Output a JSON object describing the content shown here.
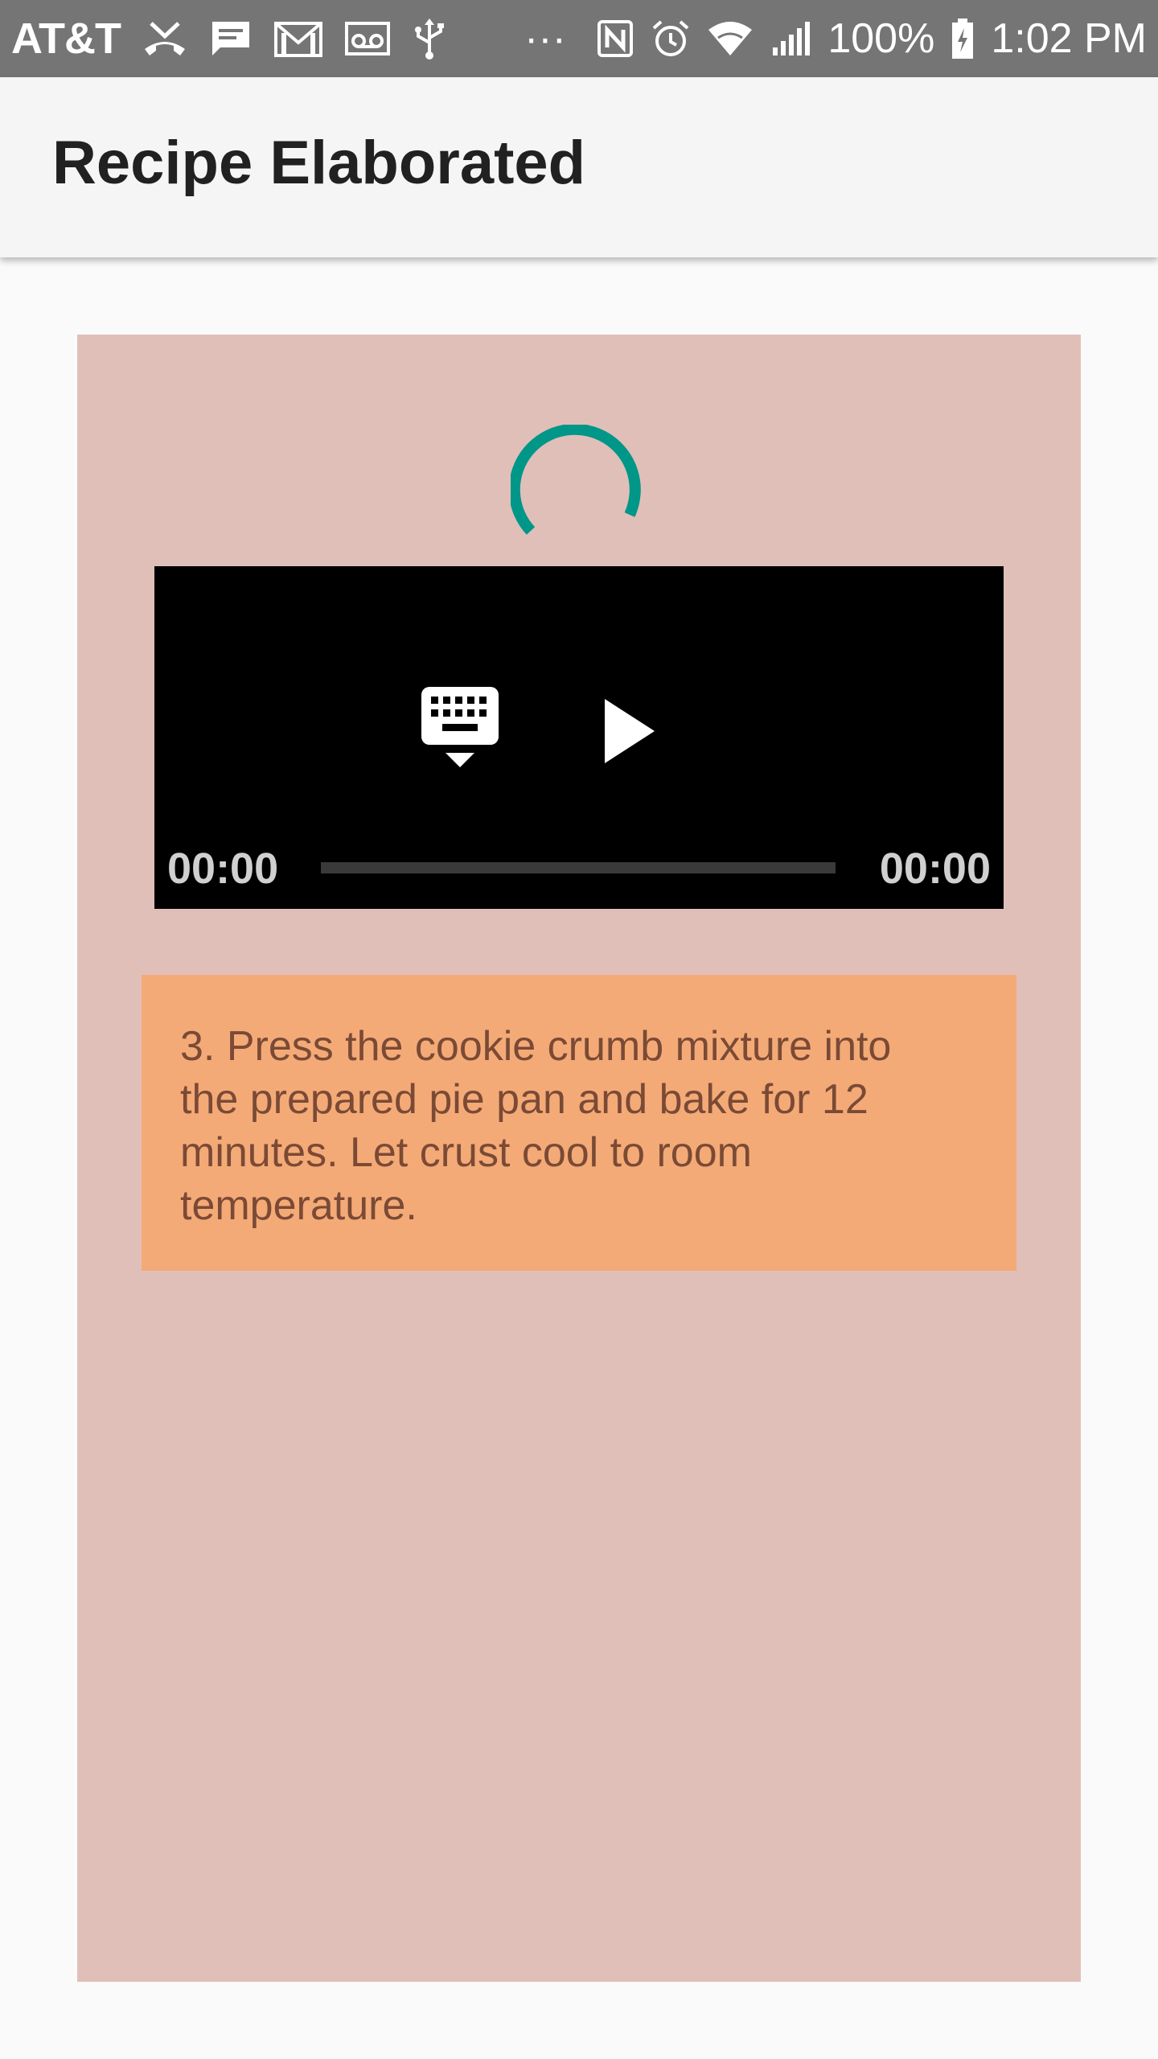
{
  "status_bar": {
    "carrier": "AT&T",
    "more": "···",
    "battery": "100%",
    "time": "1:02 PM",
    "icons": [
      "missed-call-icon",
      "message-icon",
      "gmail-icon",
      "voicemail-icon",
      "usb-icon",
      "nfc-icon",
      "alarm-icon",
      "wifi-icon",
      "signal-icon",
      "battery-charging-icon"
    ]
  },
  "app_bar": {
    "title": "Recipe Elaborated"
  },
  "loader": {
    "icon": "loading-spinner-icon",
    "color": "#009688"
  },
  "video_player": {
    "current_time": "00:00",
    "total_time": "00:00",
    "progress": 0,
    "controls": [
      "keyboard-icon",
      "play-icon"
    ]
  },
  "step": {
    "text": "3. Press the cookie crumb mixture into the prepared pie pan and bake for 12 minutes. Let crust cool to room temperature."
  },
  "colors": {
    "status_bar": "#757575",
    "app_bar": "#f5f5f5",
    "card": "#e0bfb9",
    "step_box": "#f4aa77",
    "step_text": "#7a4a35",
    "accent": "#009688"
  }
}
